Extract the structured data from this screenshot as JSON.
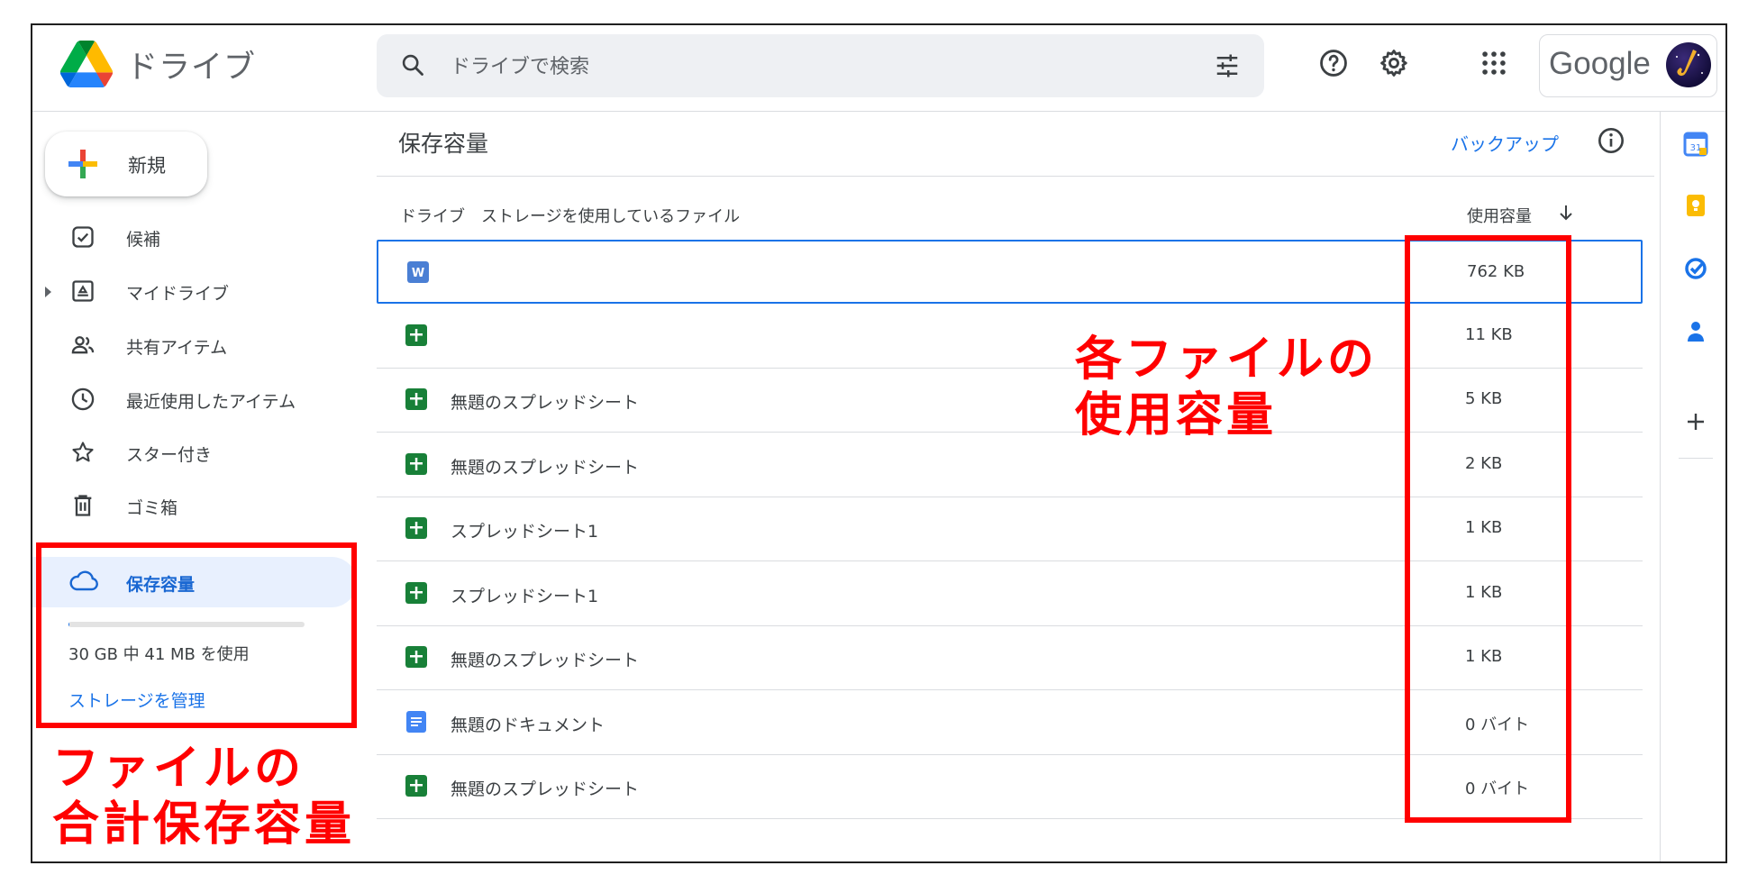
{
  "header": {
    "app_title": "ドライブ",
    "search_placeholder": "ドライブで検索",
    "google_label": "Google"
  },
  "sidebar": {
    "new_label": "新規",
    "items": [
      {
        "label": "候補",
        "icon": "check-square-icon"
      },
      {
        "label": "マイドライブ",
        "icon": "my-drive-icon"
      },
      {
        "label": "共有アイテム",
        "icon": "people-icon"
      },
      {
        "label": "最近使用したアイテム",
        "icon": "clock-icon"
      },
      {
        "label": "スター付き",
        "icon": "star-icon"
      },
      {
        "label": "ゴミ箱",
        "icon": "trash-icon"
      }
    ],
    "storage": {
      "label": "保存容量",
      "used_fraction": 0.0014,
      "quota_text": "30 GB 中 41 MB を使用",
      "manage_label": "ストレージを管理"
    }
  },
  "main": {
    "title": "保存容量",
    "backup_label": "バックアップ",
    "column_files": "ドライブ　ストレージを使用しているファイル",
    "column_size": "使用容量",
    "files": [
      {
        "name": "",
        "type": "word",
        "size": "762 KB",
        "selected": true
      },
      {
        "name": "",
        "type": "sheets",
        "size": "11 KB"
      },
      {
        "name": "無題のスプレッドシート",
        "type": "sheets",
        "size": "5 KB"
      },
      {
        "name": "無題のスプレッドシート",
        "type": "sheets",
        "size": "2 KB"
      },
      {
        "name": "スプレッドシート1",
        "type": "sheets",
        "size": "1 KB"
      },
      {
        "name": "スプレッドシート1",
        "type": "sheets",
        "size": "1 KB"
      },
      {
        "name": "無題のスプレッドシート",
        "type": "sheets",
        "size": "1 KB"
      },
      {
        "name": "無題のドキュメント",
        "type": "docs",
        "size": "0 バイト"
      },
      {
        "name": "無題のスプレッドシート",
        "type": "sheets",
        "size": "0 バイト"
      }
    ]
  },
  "rail": {
    "icons": [
      "calendar-icon",
      "keep-icon",
      "tasks-icon",
      "contacts-icon",
      "add-icon"
    ],
    "calendar_day": "31"
  },
  "annotations": {
    "file_usage": [
      "各ファイルの",
      "使用容量"
    ],
    "total_usage": [
      "ファイルの",
      "合計保存容量"
    ],
    "color": "#ff0000"
  },
  "colors": {
    "accent_blue": "#1a73e8",
    "sheets_green": "#188038",
    "docs_blue": "#4285f4",
    "word_blue": "#4a7fd4"
  }
}
